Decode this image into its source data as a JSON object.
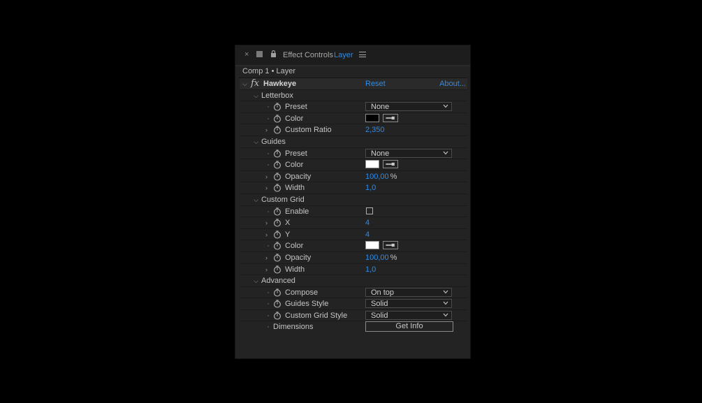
{
  "tab": {
    "close_glyph": "×",
    "title": "Effect Controls",
    "layer": "Layer",
    "icons": [
      "close-icon",
      "square-icon",
      "lock-icon",
      "hamburger-menu-icon"
    ]
  },
  "comp_title": "Comp 1 • Layer",
  "effect": {
    "name": "Hawkeye",
    "fx": "fx",
    "reset": "Reset",
    "about": "About..."
  },
  "groups": {
    "letterbox": {
      "label": "Letterbox",
      "preset_label": "Preset",
      "preset_value": "None",
      "color_label": "Color",
      "color_value": "#000000",
      "ratio_label": "Custom Ratio",
      "ratio_value": "2,350"
    },
    "guides": {
      "label": "Guides",
      "preset_label": "Preset",
      "preset_value": "None",
      "color_label": "Color",
      "color_value": "#ffffff",
      "opacity_label": "Opacity",
      "opacity_value": "100,00",
      "opacity_unit": "%",
      "width_label": "Width",
      "width_value": "1,0"
    },
    "custom_grid": {
      "label": "Custom Grid",
      "enable_label": "Enable",
      "enabled": false,
      "x_label": "X",
      "x_value": "4",
      "y_label": "Y",
      "y_value": "4",
      "color_label": "Color",
      "color_value": "#ffffff",
      "opacity_label": "Opacity",
      "opacity_value": "100,00",
      "opacity_unit": "%",
      "width_label": "Width",
      "width_value": "1,0"
    },
    "advanced": {
      "label": "Advanced",
      "compose_label": "Compose",
      "compose_value": "On top",
      "guides_style_label": "Guides Style",
      "guides_style_value": "Solid",
      "grid_style_label": "Custom Grid Style",
      "grid_style_value": "Solid",
      "dimensions_label": "Dimensions",
      "get_info": "Get Info"
    }
  },
  "colors": {
    "accent": "#2d8ceb",
    "panel_bg": "#232323"
  }
}
